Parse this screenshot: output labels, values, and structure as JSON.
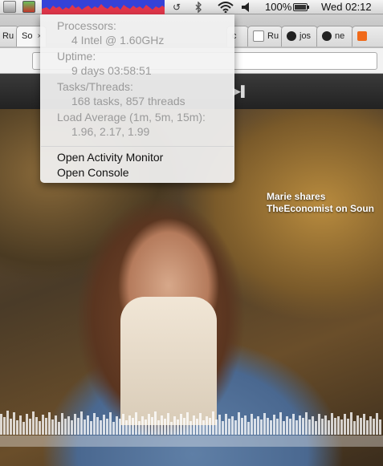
{
  "menubar": {
    "battery_text": "100%",
    "clock_text": "Wed 02:12",
    "icons": [
      "app-icon-1",
      "app-icon-2",
      "cpu-graph",
      "time-machine-icon",
      "bluetooth-icon",
      "wifi-icon",
      "volume-icon",
      "battery-icon"
    ]
  },
  "tabs": [
    {
      "label": "Ru",
      "close": "×"
    },
    {
      "label": "So",
      "close": "×"
    },
    {
      "label": "c",
      "close": ""
    },
    {
      "label": "Ru",
      "close": ""
    },
    {
      "label": "jos",
      "close": ""
    },
    {
      "label": "ne",
      "close": ""
    },
    {
      "label": "",
      "close": ""
    }
  ],
  "page": {
    "overlay_line1": "Marie shares",
    "overlay_line2": "TheEconomist on Soun"
  },
  "dropdown": {
    "processors_label": "Processors:",
    "processors_value": "4 Intel @ 1.60GHz",
    "uptime_label": "Uptime:",
    "uptime_value": "9 days 03:58:51",
    "tasks_label": "Tasks/Threads:",
    "tasks_value": "168 tasks, 857 threads",
    "load_label": "Load Average (1m, 5m, 15m):",
    "load_value": "1.96, 2.17, 1.99",
    "open_activity_monitor": "Open Activity Monitor",
    "open_console": "Open Console"
  }
}
